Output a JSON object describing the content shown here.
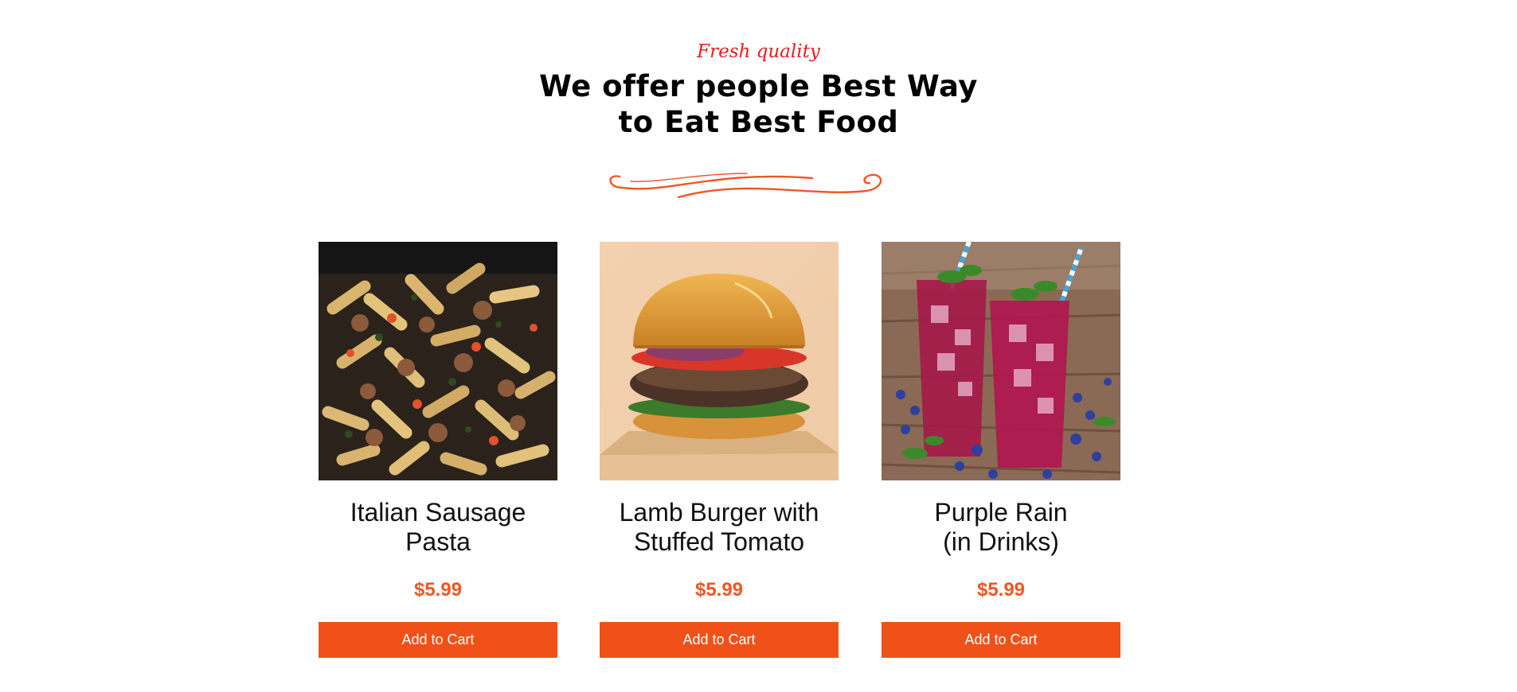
{
  "section": {
    "eyebrow": "Fresh quality",
    "headline_line1": "We offer people Best Way",
    "headline_line2": "to Eat Best Food"
  },
  "products": [
    {
      "title_line1": "Italian Sausage",
      "title_line2": "Pasta",
      "price": "$5.99",
      "button_label": "Add to Cart",
      "image": "pasta-photo"
    },
    {
      "title_line1": "Lamb Burger with",
      "title_line2": "Stuffed Tomato",
      "price": "$5.99",
      "button_label": "Add to Cart",
      "image": "burger-photo"
    },
    {
      "title_line1": "Purple Rain",
      "title_line2": "(in Drinks)",
      "price": "$5.99",
      "button_label": "Add to Cart",
      "image": "drinks-photo"
    }
  ],
  "colors": {
    "accent": "#f05118",
    "price": "#f05624",
    "eyebrow": "#e31d1d",
    "heading": "#000000"
  }
}
